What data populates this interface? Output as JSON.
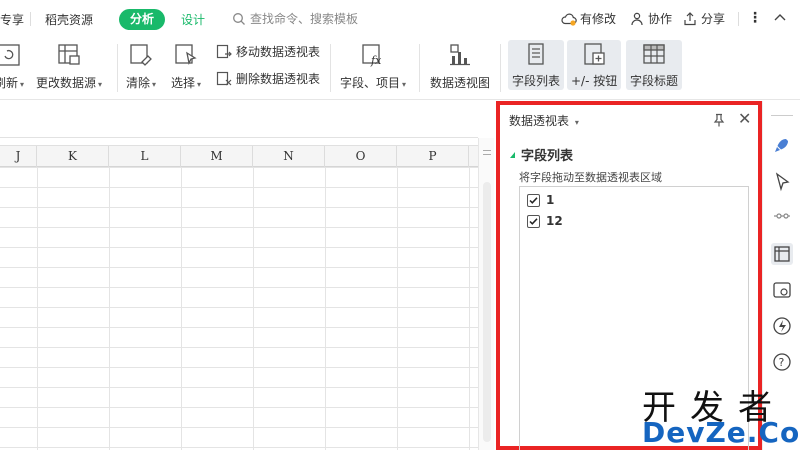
{
  "tabs": {
    "items": [
      "专享",
      "稻壳资源",
      "分析",
      "设计"
    ],
    "search_placeholder": "查找命令、搜索模板",
    "modified": "有修改",
    "collab": "协作",
    "share": "分享"
  },
  "ribbon": {
    "refresh": "刷新",
    "change_source": "更改数据源",
    "clear": "清除",
    "select": "选择",
    "move_pivot": "移动数据透视表",
    "delete_pivot": "删除数据透视表",
    "field_item": "字段、项目",
    "pivot_chart": "数据透视图",
    "field_list": "字段列表",
    "plus_minus": "+/- 按钮",
    "field_header": "字段标题"
  },
  "sheet": {
    "columns": [
      "J",
      "K",
      "L",
      "M",
      "N",
      "O",
      "P"
    ]
  },
  "pivot_panel": {
    "title": "数据透视表",
    "section_title": "字段列表",
    "hint": "将字段拖动至数据透视表区域",
    "fields": [
      {
        "label": "1",
        "checked": true
      },
      {
        "label": "12",
        "checked": true
      }
    ]
  },
  "watermark": {
    "line1": "开发者",
    "line2": "DevZe.CoM"
  },
  "colors": {
    "accent": "#19b96a",
    "highlight_border": "#ea2424"
  }
}
